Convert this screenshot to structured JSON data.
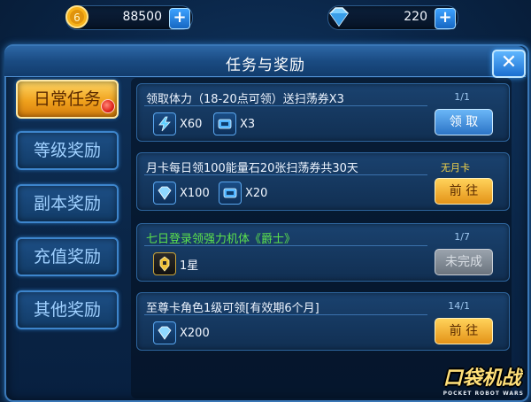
{
  "currency": {
    "coins": "88500",
    "gems": "220",
    "coin_icon": "gold-coin-icon",
    "gem_icon": "diamond-icon"
  },
  "panel": {
    "title": "任务与奖励"
  },
  "tabs": [
    {
      "label": "日常任务",
      "active": true
    },
    {
      "label": "等级奖励"
    },
    {
      "label": "副本奖励"
    },
    {
      "label": "充值奖励"
    },
    {
      "label": "其他奖励"
    }
  ],
  "quests": [
    {
      "title": "领取体力（18-20点可领）送扫荡券X3",
      "rewards": [
        {
          "icon": "stamina-bolt-icon",
          "amount": "X60"
        },
        {
          "icon": "sweep-ticket-icon",
          "amount": "X3"
        }
      ],
      "progress": "1/1",
      "button": "领 取",
      "button_style": "blue"
    },
    {
      "title": "月卡每日领100能量石20张扫荡券共30天",
      "rewards": [
        {
          "icon": "diamond-icon",
          "amount": "X100"
        },
        {
          "icon": "sweep-ticket-icon",
          "amount": "X20"
        }
      ],
      "progress": "无月卡",
      "button": "前 往",
      "button_style": "gold"
    },
    {
      "title": "七日登录领强力机体《爵士》",
      "rewards": [
        {
          "icon": "robot-unit-icon",
          "amount": "1星"
        }
      ],
      "progress": "1/7",
      "button": "未完成",
      "button_style": "gray"
    },
    {
      "title": "至尊卡角色1级可领[有效期6个月]",
      "rewards": [
        {
          "icon": "diamond-icon",
          "amount": "X200"
        }
      ],
      "progress": "14/1",
      "button": "前 往",
      "button_style": "gold"
    }
  ],
  "logo": {
    "text": "口袋机战",
    "sub": "POCKET ROBOT WARS"
  },
  "colors": {
    "accent_gold": "#f0a21d",
    "accent_blue": "#2c74c6",
    "quest_green": "#5ce34c"
  }
}
